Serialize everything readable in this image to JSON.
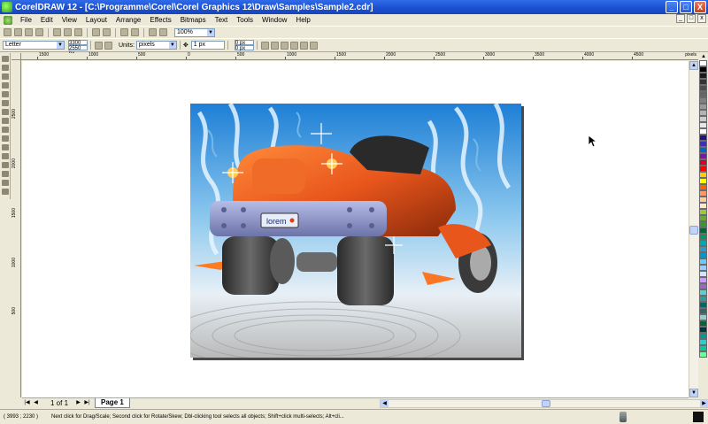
{
  "window": {
    "title": "CorelDRAW 12 - [C:\\Programme\\Corel\\Corel Graphics 12\\Draw\\Samples\\Sample2.cdr]",
    "controls": [
      "_",
      "□",
      "X"
    ]
  },
  "menu": [
    "File",
    "Edit",
    "View",
    "Layout",
    "Arrange",
    "Effects",
    "Bitmaps",
    "Text",
    "Tools",
    "Window",
    "Help"
  ],
  "mdi_controls": [
    "_",
    "□",
    "x"
  ],
  "standard_toolbar": {
    "zoom_value": "100%"
  },
  "property_bar": {
    "paper_size": "Letter",
    "width": "3300 px",
    "height": "2550 px",
    "units_label": "Units:",
    "units_value": "pixels",
    "nudge": "1 px",
    "dup_x": "0 px",
    "dup_y": "0 px"
  },
  "ruler_top": {
    "labels": [
      "1500",
      "1000",
      "500",
      "0",
      "500",
      "1000",
      "1500",
      "2000",
      "2500",
      "3000",
      "3500",
      "4000",
      "4500"
    ],
    "unit": "pixels"
  },
  "ruler_left": {
    "labels": [
      "2500",
      "2000",
      "1500",
      "1000",
      "500"
    ]
  },
  "palette": [
    "#ffffff",
    "#000000",
    "#1a1a1a",
    "#333333",
    "#4d4d4d",
    "#666666",
    "#808080",
    "#999999",
    "#b3b3b3",
    "#cccccc",
    "#e6e6e6",
    "#ffffff",
    "#2b0f83",
    "#3a2fbf",
    "#0066cc",
    "#7a1a9a",
    "#d40020",
    "#ff0000",
    "#ffcc00",
    "#ffff00",
    "#ff6600",
    "#ff9966",
    "#ffcc99",
    "#ffe6cc",
    "#99cc33",
    "#66aa33",
    "#339933",
    "#006633",
    "#009966",
    "#00aaaa",
    "#3399cc",
    "#0099cc",
    "#66ccff",
    "#99ccff",
    "#cce6ff",
    "#cc99ff",
    "#9966cc",
    "#66cccc",
    "#339999",
    "#006666",
    "#336666",
    "#99cccc",
    "#006633",
    "#003333",
    "#009999",
    "#33cccc",
    "#00cc99",
    "#66ff99"
  ],
  "pager": {
    "count": "1 of 1",
    "tab": "Page 1"
  },
  "status": {
    "coords": "( 3993 ; 2230 )",
    "message": "Next click for Drag/Scale; Second click for Rotate/Skew; Dbl-clicking tool selects all objects; Shift+click multi-selects; Alt+cli..."
  },
  "artwork": {
    "plate_text": "lorem",
    "colors": {
      "sky_top": "#1e7fd6",
      "sky_mid": "#8cc8ee",
      "body": "#e8561c",
      "bumper": "#8c93c8",
      "tire": "#3d3d3d",
      "ground": "#d8d8d8"
    }
  }
}
